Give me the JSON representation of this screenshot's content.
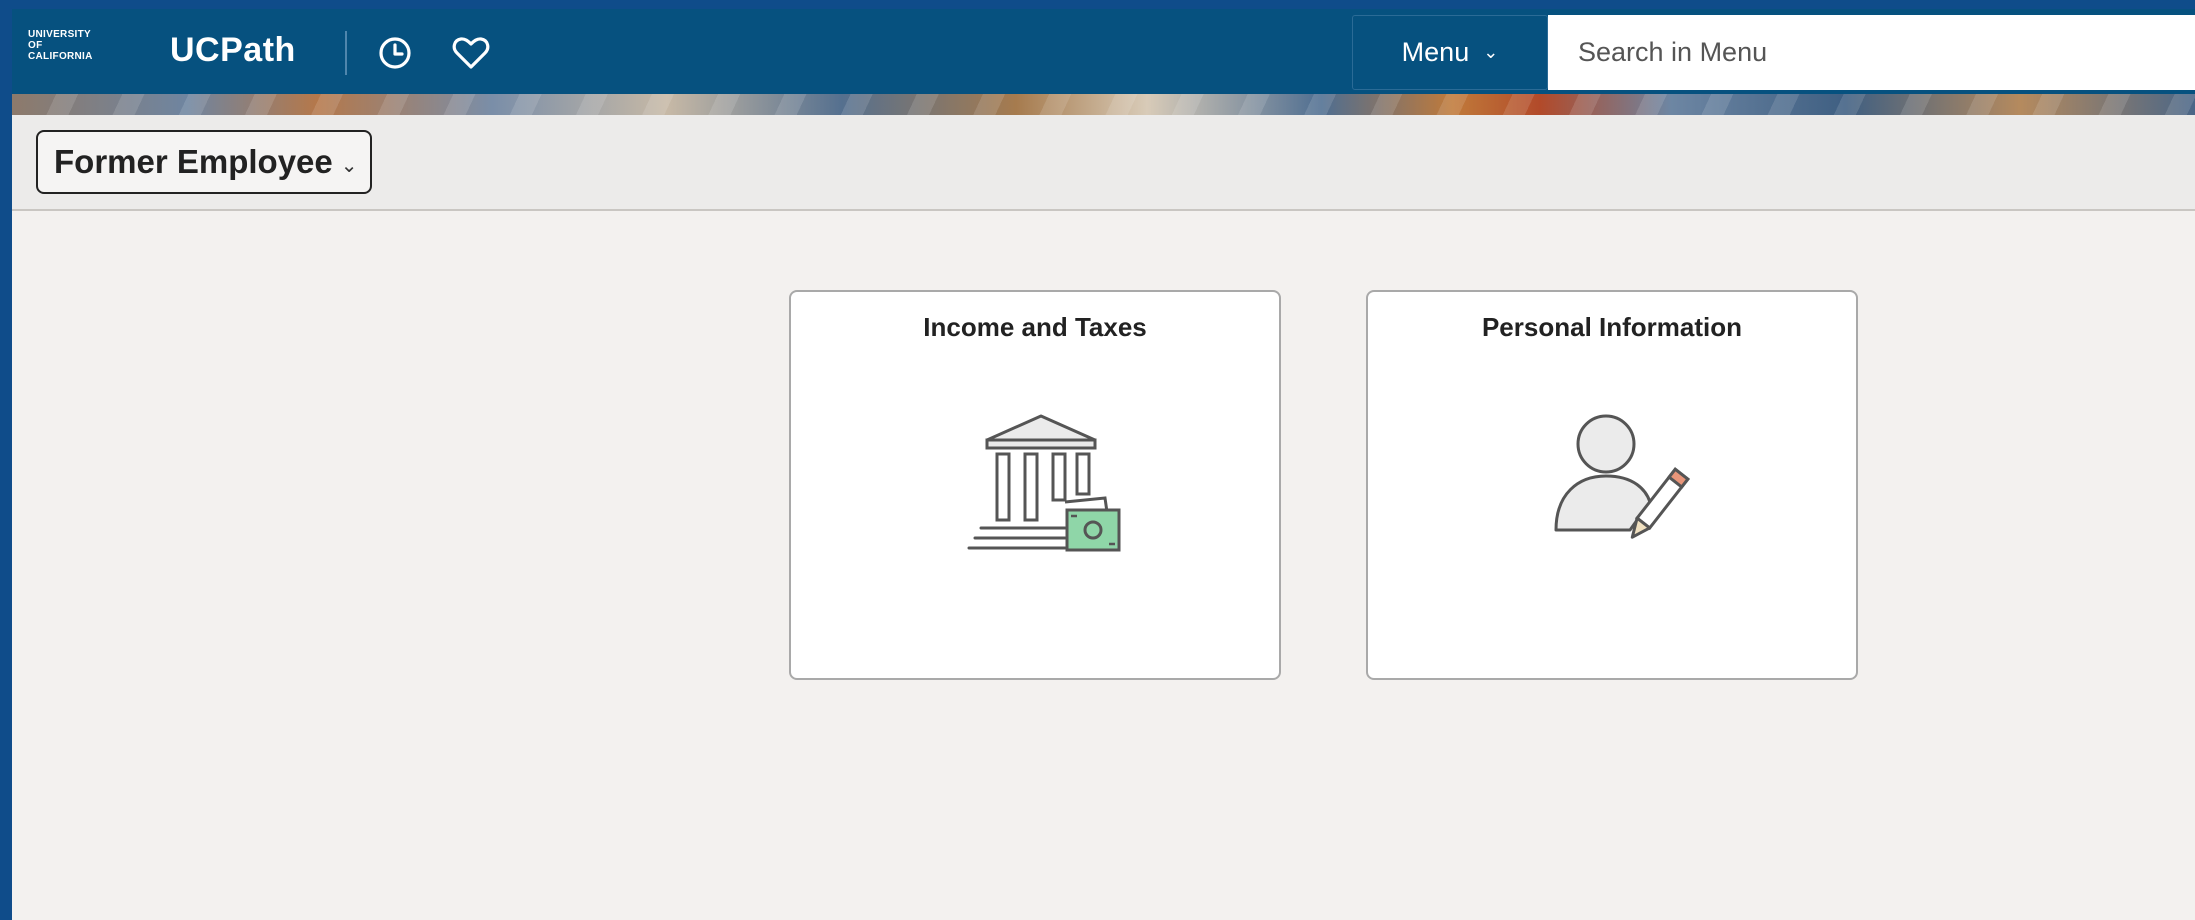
{
  "header": {
    "logo_lines": [
      "UNIVERSITY",
      "OF",
      "CALIFORNIA"
    ],
    "app_title": "UCPath",
    "menu_label": "Menu",
    "search_placeholder": "Search in Menu",
    "icons": [
      "history-icon",
      "favorites-heart-icon",
      "chevron-down-icon"
    ]
  },
  "homepage_selector": {
    "label": "Former Employee"
  },
  "tiles": [
    {
      "title": "Income and Taxes",
      "icon": "bank-with-money-icon"
    },
    {
      "title": "Personal Information",
      "icon": "person-edit-icon"
    }
  ],
  "colors": {
    "header_bg": "#06517f",
    "page_bg": "#f3f1ef",
    "outer_border": "#0f4c8a",
    "money_green": "#8fd6a8"
  }
}
